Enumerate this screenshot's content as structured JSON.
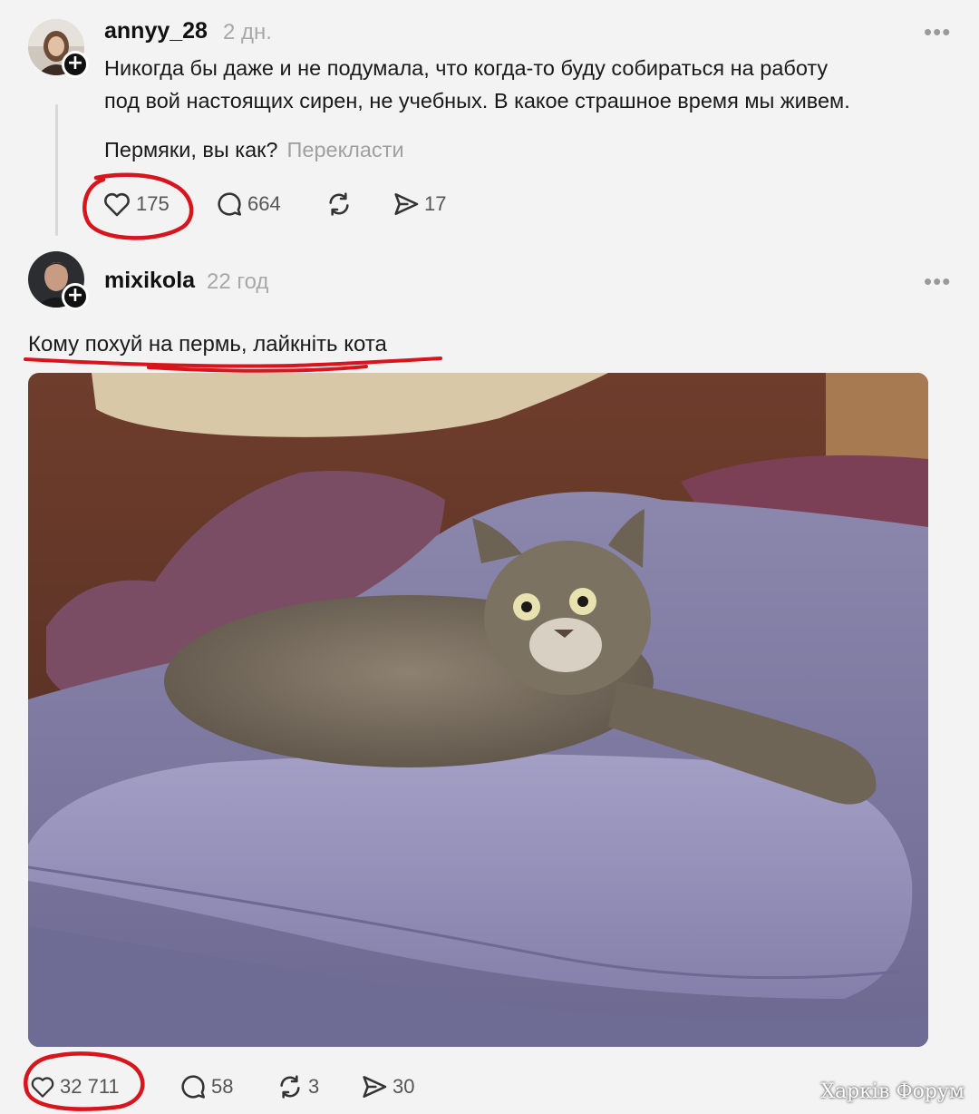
{
  "posts": [
    {
      "username": "annyy_28",
      "time": "2 дн.",
      "more_label": "•••",
      "text_line1": "Никогда бы даже и не подумала, что когда-то буду собираться на работу",
      "text_line2": "под вой настоящих сирен, не учебных. В какое страшное время мы живем.",
      "text_line3": "Пермяки, вы как?",
      "translate_label": "Перекласти",
      "likes": "175",
      "replies": "664",
      "reposts": "",
      "shares": "17"
    },
    {
      "username": "mixikola",
      "time": "22 год",
      "more_label": "•••",
      "text": "Кому похуй на пермь, лайкніть кота",
      "likes": "32 711",
      "replies": "58",
      "reposts": "3",
      "shares": "30"
    }
  ],
  "watermark": "Харків Форум",
  "colors": {
    "annotation_red": "#d8141c",
    "background": "#f3f3f3"
  },
  "icons": [
    "heart-icon",
    "reply-icon",
    "repost-icon",
    "share-icon",
    "more-icon",
    "follow-plus-icon"
  ]
}
